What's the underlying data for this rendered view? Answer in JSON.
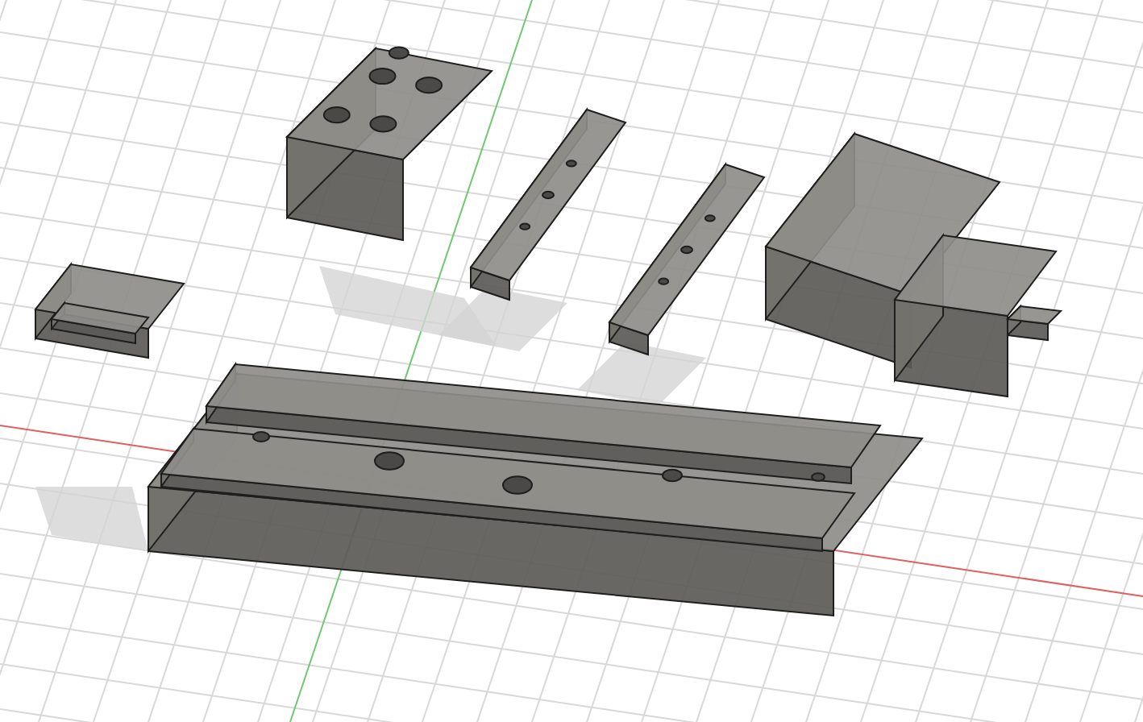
{
  "scene": {
    "grid": true,
    "axes": true
  },
  "parts": [
    {
      "kind": "jaw-block"
    },
    {
      "kind": "small-block"
    },
    {
      "kind": "jaw-plate"
    },
    {
      "kind": "jaw-plate"
    },
    {
      "kind": "screw-housing"
    },
    {
      "kind": "base-rail"
    }
  ]
}
